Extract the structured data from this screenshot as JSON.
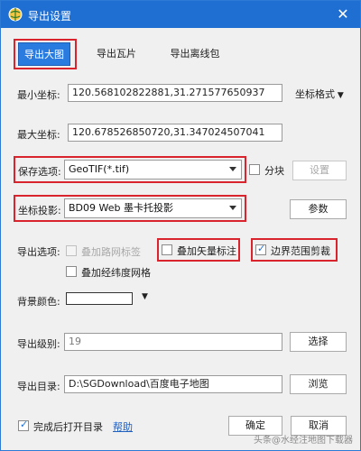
{
  "window": {
    "title": "导出设置",
    "close_glyph": "✕"
  },
  "tabs": [
    {
      "label": "导出大图",
      "active": true
    },
    {
      "label": "导出瓦片",
      "active": false
    },
    {
      "label": "导出离线包",
      "active": false
    }
  ],
  "min_coord": {
    "label": "最小坐标:",
    "value": "120.568102822881,31.271577650937"
  },
  "coord_format": {
    "label": "坐标格式"
  },
  "max_coord": {
    "label": "最大坐标:",
    "value": "120.678526850720,31.347024507041"
  },
  "save_option": {
    "label": "保存选项:",
    "value": "GeoTIF(*.tif)"
  },
  "tile_option": {
    "label": "分块",
    "checked": false
  },
  "settings_button": {
    "label": "设置"
  },
  "projection": {
    "label": "坐标投影:",
    "value": "BD09 Web 墨卡托投影"
  },
  "params_button": {
    "label": "参数"
  },
  "export_options": {
    "label": "导出选项:",
    "road_grid": {
      "label": "叠加路网标签",
      "checked": false,
      "disabled": true
    },
    "vector_annotation": {
      "label": "叠加矢量标注",
      "checked": false
    },
    "boundary_clip": {
      "label": "边界范围剪裁",
      "checked": true
    },
    "lat_lon_grid": {
      "label": "叠加经纬度网格",
      "checked": false
    }
  },
  "background_color": {
    "label": "背景颜色:",
    "value_hex": "#ffffff"
  },
  "export_level": {
    "label": "导出级别:",
    "value": "19"
  },
  "select_button": {
    "label": "选择"
  },
  "export_dir": {
    "label": "导出目录:",
    "value": "D:\\SGDownload\\百度电子地图"
  },
  "browse_button": {
    "label": "浏览"
  },
  "open_after": {
    "label": "完成后打开目录",
    "checked": true
  },
  "help_link": {
    "label": "帮助"
  },
  "ok_button": {
    "label": "确定"
  },
  "cancel_button": {
    "label": "取消"
  },
  "watermark": {
    "text": "头条@水经注地图下载器"
  },
  "colors": {
    "title_bar": "#1f6fd3",
    "highlight": "#d9232d",
    "accent": "#2a7be0"
  }
}
